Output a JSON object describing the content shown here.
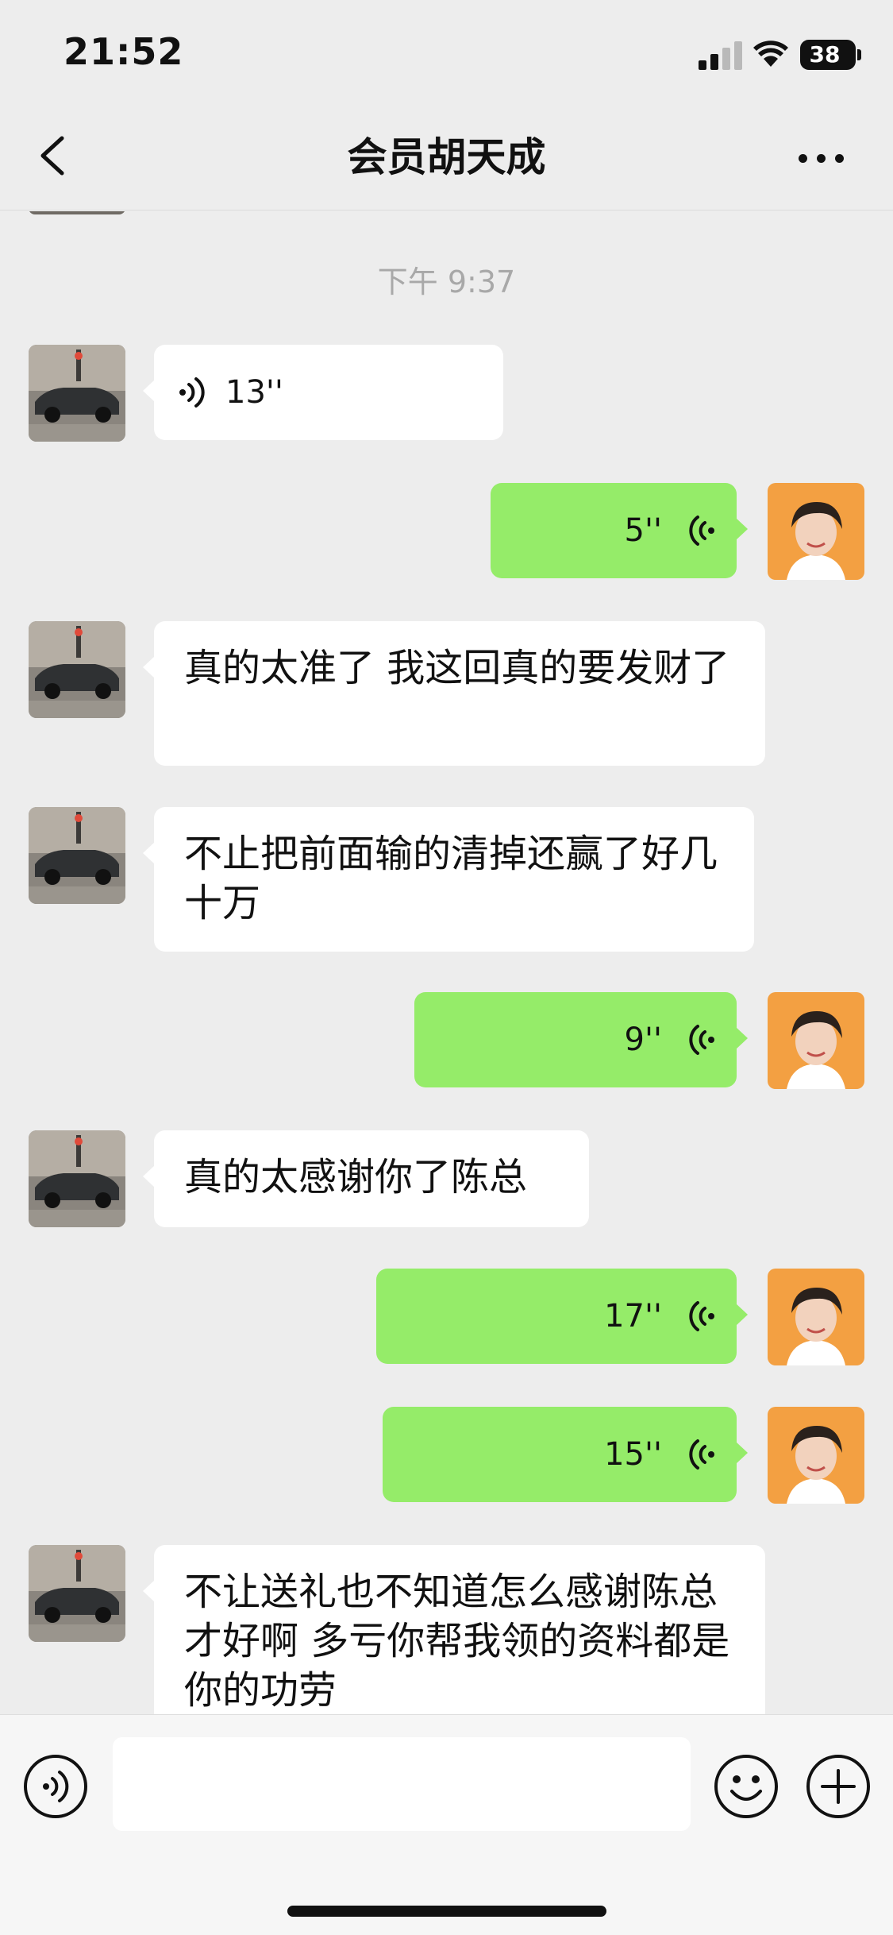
{
  "status_bar": {
    "time": "21:52",
    "battery": "38"
  },
  "header": {
    "title": "会员胡天成"
  },
  "chat": {
    "timestamp": "下午 9:37",
    "messages": [
      {
        "side": "in",
        "type": "voice",
        "duration": "13''"
      },
      {
        "side": "out",
        "type": "voice",
        "duration": "5''"
      },
      {
        "side": "in",
        "type": "text",
        "text": "真的太准了 我这回真的要发财了"
      },
      {
        "side": "in",
        "type": "text",
        "text": "不止把前面输的清掉还赢了好几十万"
      },
      {
        "side": "out",
        "type": "voice",
        "duration": "9''"
      },
      {
        "side": "in",
        "type": "text",
        "text": "真的太感谢你了陈总"
      },
      {
        "side": "out",
        "type": "voice",
        "duration": "17''"
      },
      {
        "side": "out",
        "type": "voice",
        "duration": "15''"
      },
      {
        "side": "in",
        "type": "text",
        "text": "不让送礼也不知道怎么感谢陈总才好啊  多亏你帮我领的资料都是你的功劳"
      }
    ]
  },
  "icons": {
    "back": "chevron-left-icon",
    "more": "more-dots-icon",
    "voice_toggle": "voice-icon",
    "emoji": "emoji-icon",
    "plus": "plus-icon"
  },
  "colors": {
    "outgoing_bubble": "#95ec69",
    "incoming_bubble": "#ffffff",
    "background": "#ededed"
  }
}
